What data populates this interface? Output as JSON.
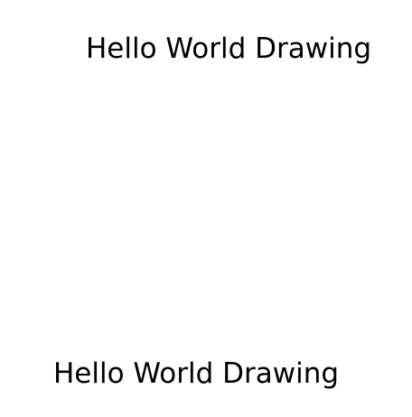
{
  "canvas": {
    "background_color": "#ffffff",
    "text_color": "#000000",
    "texts": [
      {
        "label": "Hello World Drawing"
      },
      {
        "label": "Hello World Drawing"
      }
    ]
  }
}
